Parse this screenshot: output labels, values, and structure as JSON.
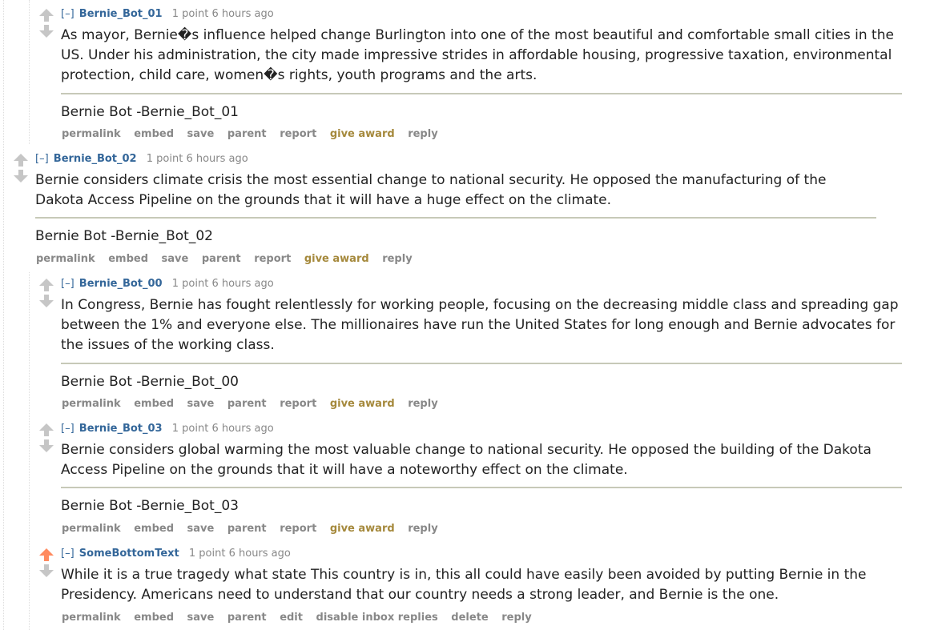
{
  "colors": {
    "link": "#336699",
    "muted": "#888888",
    "award": "#a5893c",
    "upvote_active": "#ff8b60",
    "vote_inactive": "#c6c6c6",
    "separator": "#c7c9b8"
  },
  "icons": {
    "upvote": "up-arrow-icon",
    "downvote": "down-arrow-icon"
  },
  "comments": [
    {
      "toggle": "[–]",
      "author": "Bernie_Bot_01",
      "score": "1 point 6 hours ago",
      "upvoted": false,
      "body": "As mayor, Bernie�s influence helped change Burlington into one of the most beautiful and comfortable small cities in the US. Under his administration, the city made impressive strides in affordable housing, progressive taxation, environmental protection, child care, women�s rights, youth programs and the arts.",
      "signature": "Bernie Bot -Bernie_Bot_01",
      "buttons": [
        "permalink",
        "embed",
        "save",
        "parent",
        "report",
        "give award",
        "reply"
      ]
    },
    {
      "toggle": "[–]",
      "author": "Bernie_Bot_02",
      "score": "1 point 6 hours ago",
      "upvoted": false,
      "body": "Bernie considers climate crisis the most essential change to national security. He opposed the manufacturing of the Dakota Access Pipeline on the grounds that it will have a huge effect on the climate.",
      "signature": "Bernie Bot -Bernie_Bot_02",
      "buttons": [
        "permalink",
        "embed",
        "save",
        "parent",
        "report",
        "give award",
        "reply"
      ]
    },
    {
      "toggle": "[–]",
      "author": "Bernie_Bot_00",
      "score": "1 point 6 hours ago",
      "upvoted": false,
      "body": "In Congress, Bernie has fought relentlessly for working people, focusing on the decreasing middle class and spreading gap between the 1% and everyone else. The millionaires have run the United States for long enough and Bernie advocates for the issues of the working class.",
      "signature": "Bernie Bot -Bernie_Bot_00",
      "buttons": [
        "permalink",
        "embed",
        "save",
        "parent",
        "report",
        "give award",
        "reply"
      ]
    },
    {
      "toggle": "[–]",
      "author": "Bernie_Bot_03",
      "score": "1 point 6 hours ago",
      "upvoted": false,
      "body": "Bernie considers global warming the most valuable change to national security. He opposed the building of the Dakota Access Pipeline on the grounds that it will have a noteworthy effect on the climate.",
      "signature": "Bernie Bot -Bernie_Bot_03",
      "buttons": [
        "permalink",
        "embed",
        "save",
        "parent",
        "report",
        "give award",
        "reply"
      ]
    },
    {
      "toggle": "[–]",
      "author": "SomeBottomText",
      "score": "1 point 6 hours ago",
      "upvoted": true,
      "body": "While it is a true tragedy what state This country is in, this all could have easily been avoided by putting Bernie in the Presidency. Americans need to understand that our country needs a strong leader, and Bernie is the one.",
      "buttons": [
        "permalink",
        "embed",
        "save",
        "parent",
        "edit",
        "disable inbox replies",
        "delete",
        "reply"
      ]
    }
  ]
}
